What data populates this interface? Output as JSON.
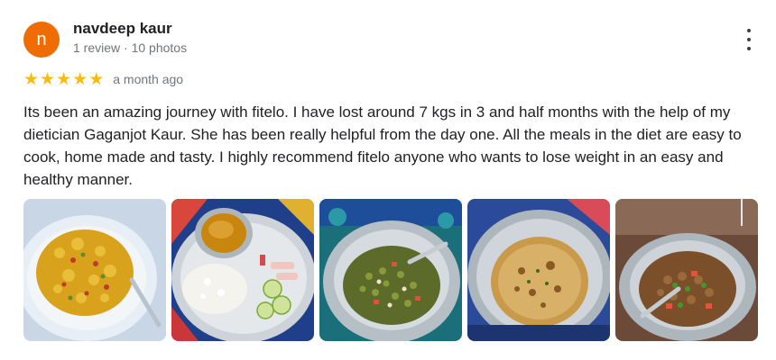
{
  "reviewer": {
    "avatar_initial": "n",
    "avatar_color": "#ef6c00",
    "name": "navdeep kaur",
    "stats": "1 review · 10 photos"
  },
  "more_menu": {
    "icon": "more-vert-icon"
  },
  "rating": {
    "stars": 5,
    "max_stars": 5,
    "star_color": "#fbbc04",
    "date": "a month ago"
  },
  "review": {
    "text": "Its been an amazing journey with fitelo. I have lost around 7 kgs in 3 and half months with the help of my dietician Gaganjot Kaur. She has been really helpful from the day one. All the meals in the diet are easy to cook, home made and tasty. I highly recommend fitelo anyone who wants to lose weight in an easy and healthy manner."
  },
  "photos": [
    {
      "subject": "upma-poha-plate"
    },
    {
      "subject": "rice-dal-salad-thali"
    },
    {
      "subject": "sprouts-salad-bowl"
    },
    {
      "subject": "paratha-plate"
    },
    {
      "subject": "chickpea-salad-bowl"
    }
  ]
}
